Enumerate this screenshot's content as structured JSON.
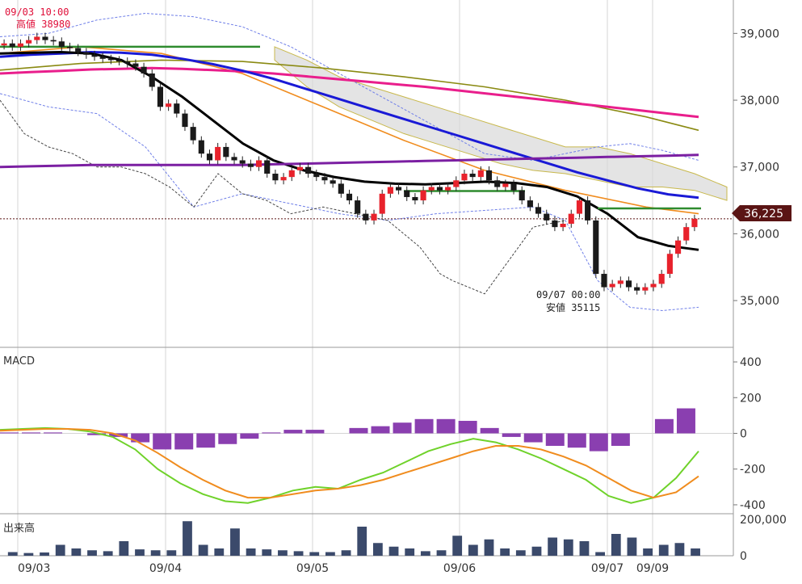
{
  "chart_data": [
    {
      "type": "candlestick",
      "title": "",
      "ylim": [
        34300,
        39500
      ],
      "y_ticks": [
        35000,
        36000,
        37000,
        38000,
        39000
      ],
      "y_tick_labels": [
        "35,000",
        "36,000",
        "37,000",
        "38,000",
        "39,000"
      ],
      "current_price": 36225,
      "current_price_label": "36,225",
      "annotations": [
        {
          "time": "09/03 10:00",
          "label_time": "09/03 10:00",
          "label_value": "高値 38980",
          "value": 38980
        },
        {
          "time": "09/07 00:00",
          "label_time": "09/07 00:00",
          "label_value": "安値 35115",
          "value": 35115
        }
      ],
      "x_ticks": [
        "09/03",
        "09/04",
        "09/05",
        "09/06",
        "09/07",
        "09/09"
      ],
      "candles_close": [
        38850,
        38800,
        38850,
        38900,
        38950,
        38900,
        38880,
        38800,
        38780,
        38720,
        38680,
        38650,
        38620,
        38600,
        38580,
        38550,
        38500,
        38400,
        38200,
        37900,
        37950,
        37800,
        37600,
        37400,
        37200,
        37100,
        37300,
        37150,
        37100,
        37050,
        37000,
        37100,
        36900,
        36800,
        36850,
        36950,
        37000,
        36900,
        36850,
        36800,
        36750,
        36600,
        36500,
        36300,
        36200,
        36300,
        36600,
        36700,
        36650,
        36550,
        36500,
        36650,
        36700,
        36650,
        36700,
        36800,
        36900,
        36850,
        36950,
        36800,
        36700,
        36750,
        36650,
        36500,
        36400,
        36300,
        36200,
        36100,
        36150,
        36300,
        36500,
        36200,
        35400,
        35200,
        35250,
        35300,
        35200,
        35150,
        35200,
        35250,
        35400,
        35700,
        35900,
        36100,
        36225
      ],
      "series": [
        {
          "name": "",
          "role": "ema-long",
          "color": "#e91e8c",
          "values": [
            38400,
            38420,
            38440,
            38460,
            38470,
            38480,
            38470,
            38450,
            38430,
            38400,
            38360,
            38320,
            38280,
            38240,
            38200,
            38150,
            38100,
            38050,
            38000,
            37950,
            37900,
            37850,
            37800,
            37750
          ]
        },
        {
          "name": "",
          "role": "sma-mid",
          "color": "#1a1ad6",
          "values": [
            38650,
            38680,
            38700,
            38720,
            38710,
            38680,
            38620,
            38540,
            38440,
            38320,
            38180,
            38040,
            37900,
            37760,
            37620,
            37480,
            37340,
            37200,
            37060,
            36920,
            36800,
            36680,
            36590,
            36540
          ]
        },
        {
          "name": "",
          "role": "sma-short",
          "color": "#000000",
          "values": [
            38700,
            38710,
            38720,
            38700,
            38600,
            38350,
            38050,
            37700,
            37350,
            37100,
            36950,
            36850,
            36780,
            36750,
            36740,
            36760,
            36780,
            36760,
            36700,
            36560,
            36300,
            35950,
            35820,
            35760
          ]
        },
        {
          "name": "",
          "role": "flat-line",
          "color": "#7b1fa2",
          "values": [
            37000,
            37010,
            37020,
            37030,
            37030,
            37030,
            37030,
            37030,
            37030,
            37040,
            37050,
            37060,
            37070,
            37080,
            37090,
            37100,
            37110,
            37120,
            37130,
            37140,
            37150,
            37160,
            37170,
            37180
          ]
        }
      ],
      "macd": {
        "title": "MACD",
        "ylim": [
          -450,
          450
        ],
        "y_ticks": [
          -400,
          -200,
          0,
          200,
          400
        ],
        "y_tick_labels": [
          "-400",
          "-200",
          "0",
          "200",
          "400"
        ],
        "macd_line": [
          20,
          25,
          30,
          25,
          10,
          -20,
          -90,
          -200,
          -280,
          -340,
          -380,
          -390,
          -360,
          -320,
          -300,
          -310,
          -260,
          -220,
          -160,
          -100,
          -60,
          -30,
          -50,
          -90,
          -140,
          -200,
          -260,
          -350,
          -390,
          -360,
          -250,
          -100
        ],
        "signal_line": [
          15,
          20,
          25,
          25,
          20,
          0,
          -40,
          -110,
          -190,
          -260,
          -320,
          -360,
          -360,
          -340,
          -320,
          -310,
          -290,
          -260,
          -220,
          -180,
          -140,
          -100,
          -70,
          -70,
          -90,
          -130,
          -180,
          -250,
          -320,
          -360,
          -330,
          -240
        ],
        "histogram": [
          5,
          5,
          5,
          0,
          -10,
          -20,
          -50,
          -90,
          -90,
          -80,
          -60,
          -30,
          5,
          20,
          20,
          0,
          30,
          40,
          60,
          80,
          80,
          70,
          30,
          -20,
          -50,
          -70,
          -80,
          -100,
          -70,
          0,
          80,
          140
        ]
      },
      "volume": {
        "title": "出来高",
        "ylim": [
          0,
          200000
        ],
        "y_ticks": [
          0,
          200000
        ],
        "y_tick_labels": [
          "0",
          "200,000"
        ],
        "values": [
          20000,
          15000,
          18000,
          60000,
          40000,
          30000,
          25000,
          80000,
          35000,
          30000,
          30000,
          190000,
          60000,
          40000,
          150000,
          40000,
          35000,
          30000,
          25000,
          20000,
          20000,
          30000,
          160000,
          70000,
          50000,
          40000,
          25000,
          30000,
          110000,
          60000,
          90000,
          40000,
          30000,
          50000,
          100000,
          90000,
          80000,
          20000,
          120000,
          100000,
          40000,
          60000,
          70000,
          40000
        ]
      }
    }
  ]
}
